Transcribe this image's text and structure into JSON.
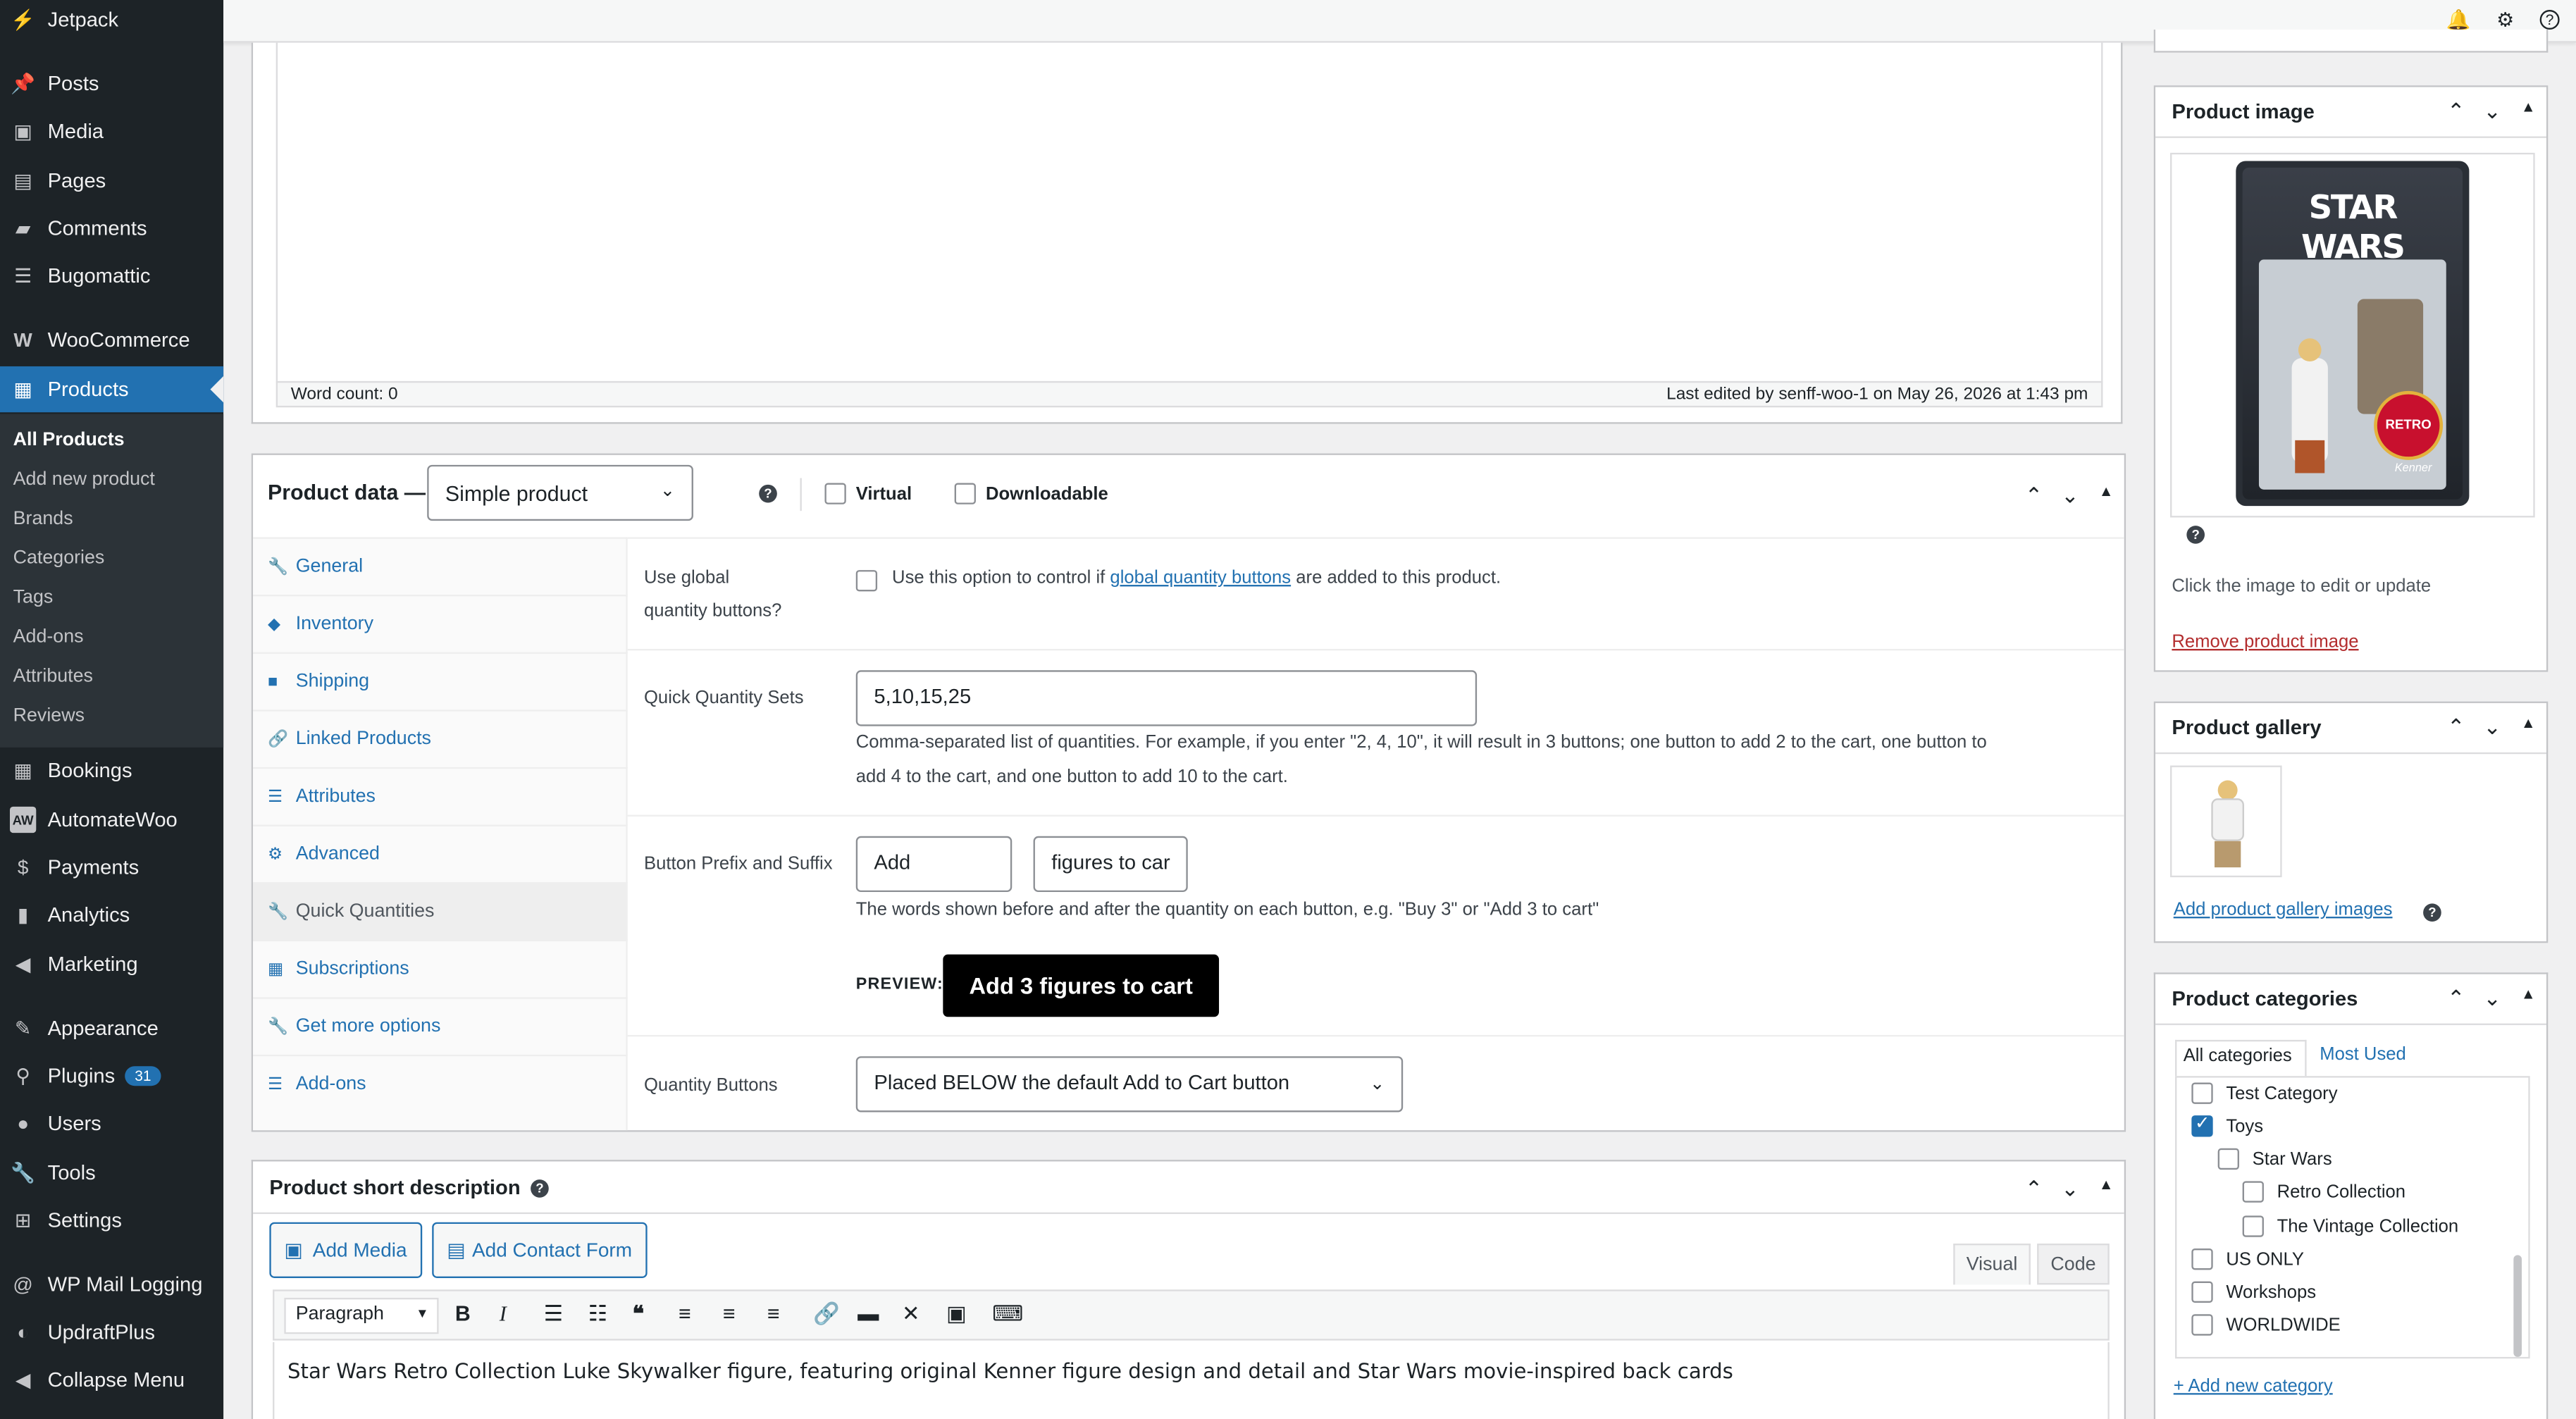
{
  "sidebar": {
    "items": [
      {
        "label": "Jetpack",
        "icon": "jetpack-icon"
      },
      {
        "label": "Posts",
        "icon": "pin-icon"
      },
      {
        "label": "Media",
        "icon": "media-icon"
      },
      {
        "label": "Pages",
        "icon": "page-icon"
      },
      {
        "label": "Comments",
        "icon": "comment-icon"
      },
      {
        "label": "Bugomattic",
        "icon": "list-icon"
      },
      {
        "label": "WooCommerce",
        "icon": "woo-icon"
      },
      {
        "label": "Products",
        "icon": "archive-icon"
      },
      {
        "label": "Bookings",
        "icon": "calendar-icon"
      },
      {
        "label": "AutomateWoo",
        "icon": "aw-icon"
      },
      {
        "label": "Payments",
        "icon": "dollar-icon"
      },
      {
        "label": "Analytics",
        "icon": "bar-chart-icon"
      },
      {
        "label": "Marketing",
        "icon": "megaphone-icon"
      },
      {
        "label": "Appearance",
        "icon": "brush-icon"
      },
      {
        "label": "Plugins",
        "icon": "plugin-icon",
        "badge": "31"
      },
      {
        "label": "Users",
        "icon": "user-icon"
      },
      {
        "label": "Tools",
        "icon": "wrench-icon"
      },
      {
        "label": "Settings",
        "icon": "settings-icon"
      },
      {
        "label": "WP Mail Logging",
        "icon": "at-icon"
      },
      {
        "label": "UpdraftPlus",
        "icon": "updraft-icon"
      },
      {
        "label": "Collapse Menu",
        "icon": "collapse-icon"
      }
    ],
    "submenu": [
      "All Products",
      "Add new product",
      "Brands",
      "Categories",
      "Tags",
      "Add-ons",
      "Attributes",
      "Reviews"
    ]
  },
  "editor": {
    "word_count": "Word count: 0",
    "last_edited": "Last edited by senff-woo-1 on May 26, 2026 at 1:43 pm"
  },
  "product_data": {
    "title": "Product data —",
    "type_value": "Simple product",
    "virtual_label": "Virtual",
    "downloadable_label": "Downloadable",
    "tabs": [
      {
        "label": "General",
        "icon": "wrench-icon"
      },
      {
        "label": "Inventory",
        "icon": "tag-icon"
      },
      {
        "label": "Shipping",
        "icon": "truck-icon"
      },
      {
        "label": "Linked Products",
        "icon": "link-icon"
      },
      {
        "label": "Attributes",
        "icon": "list-icon"
      },
      {
        "label": "Advanced",
        "icon": "gear-icon"
      },
      {
        "label": "Quick Quantities",
        "icon": "wrench-icon"
      },
      {
        "label": "Subscriptions",
        "icon": "calendar-icon"
      },
      {
        "label": "Get more options",
        "icon": "wrench-icon"
      },
      {
        "label": "Add-ons",
        "icon": "list-icon"
      }
    ],
    "global_label_1": "Use global",
    "global_label_2": "quantity buttons?",
    "global_text_before": "Use this option to control if",
    "global_link": "global quantity buttons",
    "global_text_after": "are added to this product.",
    "sets_label": "Quick Quantity Sets",
    "sets_value": "5,10,15,25",
    "sets_desc_1": "Comma-separated list of quantities. For example, if you enter \"2, 4, 10\", it will result in 3 buttons; one button to add 2 to the cart, one button to",
    "sets_desc_2": "add 4 to the cart, and one button to add 10 to the cart.",
    "prefix_label": "Button Prefix and Suffix",
    "prefix_value": "Add",
    "suffix_value": "figures to car",
    "prefix_desc": "The words shown before and after the quantity on each button, e.g. \"Buy 3\" or \"Add 3 to cart\"",
    "preview_label": "PREVIEW:",
    "preview_button": "Add 3 figures to cart",
    "qb_label": "Quantity Buttons",
    "qb_value": "Placed BELOW the default Add to Cart button"
  },
  "short_desc": {
    "title": "Product short description",
    "add_media": "Add Media",
    "add_contact": "Add Contact Form",
    "tab_visual": "Visual",
    "tab_code": "Code",
    "format": "Paragraph",
    "content": "Star Wars Retro Collection Luke Skywalker figure, featuring original Kenner figure design and detail and Star Wars movie-inspired back cards"
  },
  "product_image": {
    "title": "Product image",
    "hint": "Click the image to edit or update",
    "remove": "Remove product image",
    "package_brand": "STAR WARS",
    "package_badge": "RETRO",
    "package_maker": "Kenner"
  },
  "gallery": {
    "title": "Product gallery",
    "add": "Add product gallery images"
  },
  "categories": {
    "title": "Product categories",
    "tab_all": "All categories",
    "tab_used": "Most Used",
    "items": [
      {
        "label": "Test Category",
        "checked": false
      },
      {
        "label": "Toys",
        "checked": true
      },
      {
        "label": "Star Wars",
        "checked": false
      },
      {
        "label": "Retro Collection",
        "checked": false
      },
      {
        "label": "The Vintage Collection",
        "checked": false
      },
      {
        "label": "US ONLY",
        "checked": false
      },
      {
        "label": "Workshops",
        "checked": false
      },
      {
        "label": "WORLDWIDE",
        "checked": false
      }
    ],
    "add_new": "+ Add new category"
  },
  "colors": {
    "accent": "#2271b1",
    "sidebar": "#1d2327",
    "submenu": "#2c3338"
  }
}
